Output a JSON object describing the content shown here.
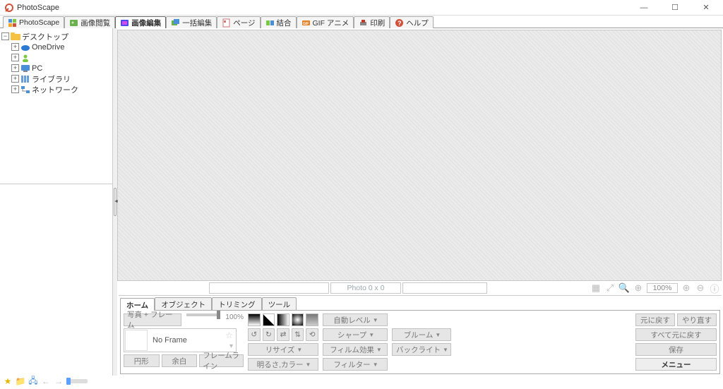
{
  "window": {
    "title": "PhotoScape",
    "minimize": "—",
    "maximize": "☐",
    "close": "✕"
  },
  "top_tabs": [
    {
      "label": "PhotoScape"
    },
    {
      "label": "画像閲覧"
    },
    {
      "label": "画像編集"
    },
    {
      "label": "一括編集"
    },
    {
      "label": "ページ"
    },
    {
      "label": "結合"
    },
    {
      "label": "GIF アニメ"
    },
    {
      "label": "印刷"
    },
    {
      "label": "ヘルプ"
    }
  ],
  "active_top_tab": 2,
  "tree": {
    "root": "デスクトップ",
    "children": [
      {
        "label": "OneDrive",
        "icon": "cloud"
      },
      {
        "label": "",
        "icon": "user"
      },
      {
        "label": "PC",
        "icon": "pc"
      },
      {
        "label": "ライブラリ",
        "icon": "library"
      },
      {
        "label": "ネットワーク",
        "icon": "network"
      }
    ]
  },
  "status": {
    "photo_dims": "Photo 0 x 0",
    "zoom": "100%"
  },
  "sub_tabs": [
    "ホーム",
    "オブジェクト",
    "トリミング",
    "ツール"
  ],
  "active_sub_tab": 0,
  "panel": {
    "photo_frame_btn": "写真 + フレーム",
    "opacity_pct": "100%",
    "frame_selected": "No Frame",
    "shape_buttons": [
      "円形",
      "余白",
      "フレームライン"
    ],
    "adjust_col1": [
      "リサイズ",
      "明るさ,カラー"
    ],
    "adjust_col2": [
      "自動レベル",
      "シャープ",
      "フィルム効果",
      "フィルター"
    ],
    "adjust_col3": [
      "ブルーム",
      "バックライト"
    ]
  },
  "right_buttons": {
    "undo": "元に戻す",
    "redo": "やり直す",
    "undo_all": "すべて元に戻す",
    "save": "保存",
    "menu": "メニュー"
  }
}
